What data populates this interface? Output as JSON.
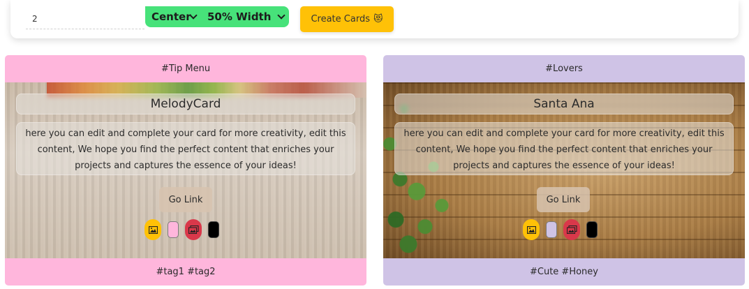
{
  "toolbar": {
    "count_value": "2",
    "align_selected": "Center",
    "width_selected": "50% Width",
    "create_label": "Create Cards",
    "create_emoji": "😻"
  },
  "colors": {
    "select_bg": "#47e27a",
    "create_bg": "#ffc107",
    "card1_accent": "#ffb6dc",
    "card2_accent": "#cfc3e6",
    "image_tool": "#ffc107",
    "images_tool": "#d9384a",
    "text_color_swatch": "#000000"
  },
  "cards": [
    {
      "header": "#Tip Menu",
      "title": "MelodyCard",
      "text": "here you can edit and complete your card for more creativity, edit this content, We hope you find the perfect content that enriches your projects and captures the essence of your ideas!",
      "link_label": "Go Link",
      "footer": "#tag1 #tag2",
      "background": "light wood with autumn leaves"
    },
    {
      "header": "#Lovers",
      "title": "Santa Ana",
      "text": "here you can edit and complete your card for more creativity, edit this content, We hope you find the perfect content that enriches your projects and captures the essence of your ideas!",
      "link_label": "Go Link",
      "footer": "#Cute #Honey",
      "background": "brown wood planks with ivy"
    }
  ],
  "icons": {
    "image_tool": "image-icon",
    "images_tool": "images-icon"
  }
}
